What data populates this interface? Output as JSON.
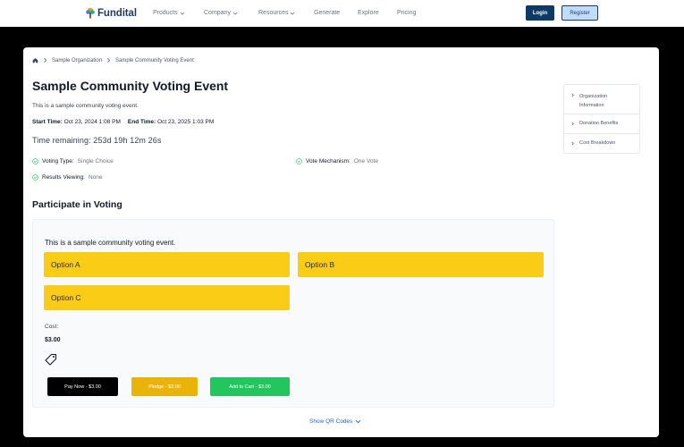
{
  "brand": {
    "name": "Fundital"
  },
  "nav": {
    "items": [
      {
        "label": "Products",
        "dropdown": true
      },
      {
        "label": "Company",
        "dropdown": true
      },
      {
        "label": "Resources",
        "dropdown": true
      },
      {
        "label": "Generate",
        "dropdown": false
      },
      {
        "label": "Explore",
        "dropdown": false
      },
      {
        "label": "Pricing",
        "dropdown": false
      }
    ],
    "login_label": "Login",
    "register_label": "Register"
  },
  "breadcrumb": {
    "items": [
      "Sample Organization",
      "Sample Community Voting Event"
    ]
  },
  "event": {
    "title": "Sample Community Voting Event",
    "description": "This is a sample community voting event.",
    "start_label": "Start Time:",
    "start_value": "Oct 23, 2024 1:08 PM",
    "end_label": "End Time:",
    "end_value": "Oct 23, 2025 1:03 PM",
    "remaining": "Time remaining: 253d 19h 12m 26s",
    "voting_type_label": "Voting Type:",
    "voting_type_value": "Single Choice",
    "mechanism_label": "Vote Mechanism:",
    "mechanism_value": "One Vote",
    "results_label": "Results Viewing:",
    "results_value": "None"
  },
  "voting": {
    "section_title": "Participate in Voting",
    "prompt": "This is a sample community voting event.",
    "options": [
      "Option A",
      "Option B",
      "Option C"
    ],
    "cost_label": "Cost:",
    "cost_value": "$3.00",
    "pay_label": "Pay Now - $3.00",
    "pledge_label": "Pledge - $3.00",
    "cart_label": "Add to Cart - $3.00",
    "show_qr_label": "Show QR Codes"
  },
  "sidebar": {
    "items": [
      {
        "label": "Organization Information"
      },
      {
        "label": "Donation Benefits"
      },
      {
        "label": "Cost Breakdown"
      }
    ]
  },
  "colors": {
    "option": "#facc15",
    "pay": "#000000",
    "pledge": "#eab308",
    "cart": "#22c55e",
    "accent": "#2563eb",
    "check": "#22c55e",
    "login": "#0d3b66"
  }
}
